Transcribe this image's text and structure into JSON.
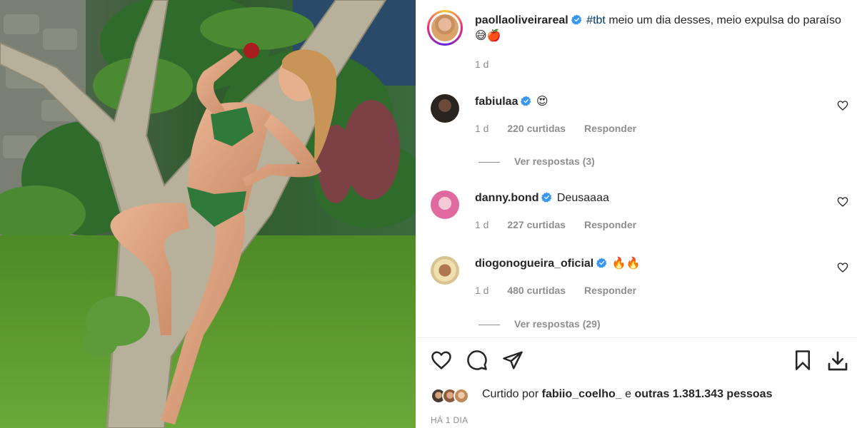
{
  "post": {
    "author": "paollaoliveirareal",
    "caption_hashtag": "#tbt",
    "caption_text": "meio um dia desses, meio expulsa do paraíso 😅🍎",
    "time": "1 d"
  },
  "comments": [
    {
      "user": "fabiulaa",
      "text": "😍",
      "time": "1 d",
      "likes": "220 curtidas",
      "reply": "Responder",
      "view_replies": "Ver respostas (3)"
    },
    {
      "user": "danny.bond",
      "text": "Deusaaaa",
      "time": "1 d",
      "likes": "227 curtidas",
      "reply": "Responder"
    },
    {
      "user": "diogonogueira_oficial",
      "text": "🔥🔥",
      "time": "1 d",
      "likes": "480 curtidas",
      "reply": "Responder",
      "view_replies": "Ver respostas (29)"
    }
  ],
  "likes": {
    "prefix": "Curtido por",
    "user": "fabiio_coelho_",
    "joiner": "e",
    "others": "outras 1.381.343 pessoas"
  },
  "post_time_label": "HÁ 1 DIA",
  "icons": [
    "heart-icon",
    "comment-icon",
    "share-icon",
    "bookmark-icon",
    "download-icon",
    "verified-badge-icon"
  ],
  "colors": {
    "verified": "#3897f0",
    "text": "#262626",
    "muted": "#8e8e8e",
    "hashtag": "#00376b"
  }
}
